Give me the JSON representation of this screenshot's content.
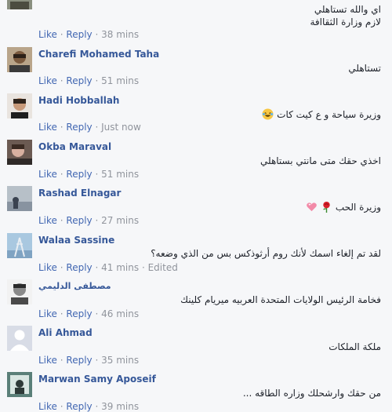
{
  "actions": {
    "like": "Like",
    "reply": "Reply",
    "sep": "·",
    "edited": "Edited"
  },
  "comments": [
    {
      "name": "",
      "text_lines": [
        "اي والله تستاهلي",
        "لازم وزارة الثقاافة"
      ],
      "time": "38 mins"
    },
    {
      "name": "Charefi Mohamed Taha",
      "text_lines": [
        "تستاهلي"
      ],
      "time": "51 mins"
    },
    {
      "name": "Hadi Hobballah",
      "text_lines": [
        "وزيرة سياحة و ع كيت كات"
      ],
      "time": "Just now",
      "emoji": "laughing-tears-icon"
    },
    {
      "name": "Okba Maraval",
      "text_lines": [
        "اخذي حقك متى مانتي بستاهلي"
      ],
      "time": "51 mins"
    },
    {
      "name": "Rashad Elnagar",
      "text_lines": [
        "وزيرة الحب"
      ],
      "time": "27 mins",
      "emoji": "rose-heart-icon"
    },
    {
      "name": "Walaa Sassine",
      "text_lines": [
        "لقد تم إلغاء اسمك لأنك روم أرثوذكس بس من الذي وضعه؟"
      ],
      "time": "41 mins",
      "edited": true
    },
    {
      "name": "مصطفى الدليمي",
      "text_lines": [
        "فخامة الرئيس الولايات المتحدة العربيه ميريام كلينك"
      ],
      "time": "46 mins"
    },
    {
      "name": "Ali Ahmad",
      "text_lines": [
        "ملكة الملكات"
      ],
      "time": "35 mins"
    },
    {
      "name": "Marwan Samy Aposeif",
      "text_lines": [
        "من حقك وارشحلك وزاره الطاقه ..."
      ],
      "time": "39 mins"
    }
  ]
}
